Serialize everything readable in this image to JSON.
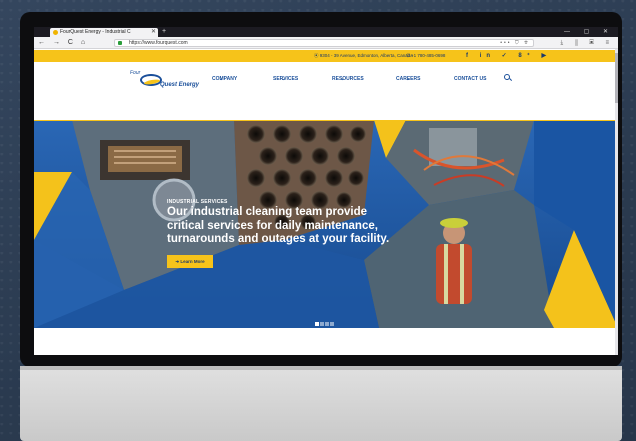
{
  "browser": {
    "tab_title": "FourQuest Energy - Industrial C",
    "close_tab": "✕",
    "new_tab": "+",
    "window_controls": "— ▢ ✕",
    "nav_buttons": "← → C ⌂",
    "url": "https://www.fourquest.com",
    "url_actions": "••• ⛉ ☆",
    "toolbar_icons": "⤓ ⫼ ▣ ≡"
  },
  "topbar": {
    "address": "9304 - 39 Avenue, Edmonton, Alberta, Canada",
    "phone": "+1 780-485-0698",
    "social": "f in ✓ 8⁺ ▶"
  },
  "logo": {
    "line1": "Four",
    "line2": "Quest Energy"
  },
  "menu": {
    "items": [
      "COMPANY",
      "SERVICES",
      "RESOURCES",
      "CAREERS",
      "CONTACT US"
    ],
    "chevron": "⌄"
  },
  "hero": {
    "eyebrow": "INDUSTRIAL SERVICES",
    "headline": "Our industrial cleaning team provide critical services for daily maintenance, turnarounds and outages at your facility.",
    "button": "➜ Learn More",
    "slides": 4,
    "active_slide": 0
  },
  "colors": {
    "brand_blue": "#1a4f9a",
    "brand_yellow": "#f6c31a"
  }
}
